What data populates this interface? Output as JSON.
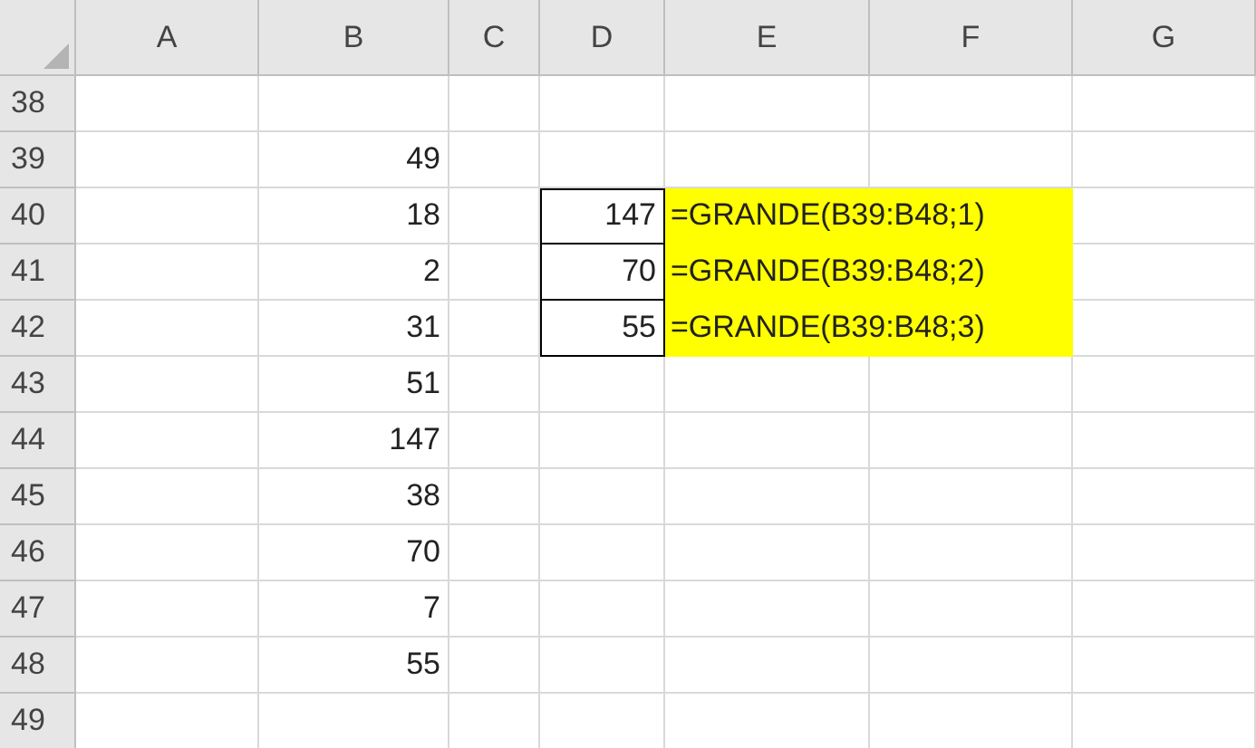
{
  "columns": [
    "A",
    "B",
    "C",
    "D",
    "E",
    "F",
    "G"
  ],
  "rows": [
    {
      "label": "38"
    },
    {
      "label": "39",
      "b": {
        "value": "49"
      }
    },
    {
      "label": "40",
      "b": {
        "value": "18"
      },
      "d": {
        "value": "147",
        "border": true
      },
      "e": {
        "value": "=GRANDE(B39:B48;1)",
        "highlighted": true
      }
    },
    {
      "label": "41",
      "b": {
        "value": "2"
      },
      "d": {
        "value": "70",
        "border": true
      },
      "e": {
        "value": "=GRANDE(B39:B48;2)",
        "highlighted": true
      }
    },
    {
      "label": "42",
      "b": {
        "value": "31"
      },
      "d": {
        "value": "55",
        "border": true
      },
      "e": {
        "value": "=GRANDE(B39:B48;3)",
        "highlighted": true
      }
    },
    {
      "label": "43",
      "b": {
        "value": "51"
      }
    },
    {
      "label": "44",
      "b": {
        "value": "147"
      }
    },
    {
      "label": "45",
      "b": {
        "value": "38"
      }
    },
    {
      "label": "46",
      "b": {
        "value": "70"
      }
    },
    {
      "label": "47",
      "b": {
        "value": "7"
      }
    },
    {
      "label": "48",
      "b": {
        "value": "55"
      }
    },
    {
      "label": "49"
    }
  ]
}
